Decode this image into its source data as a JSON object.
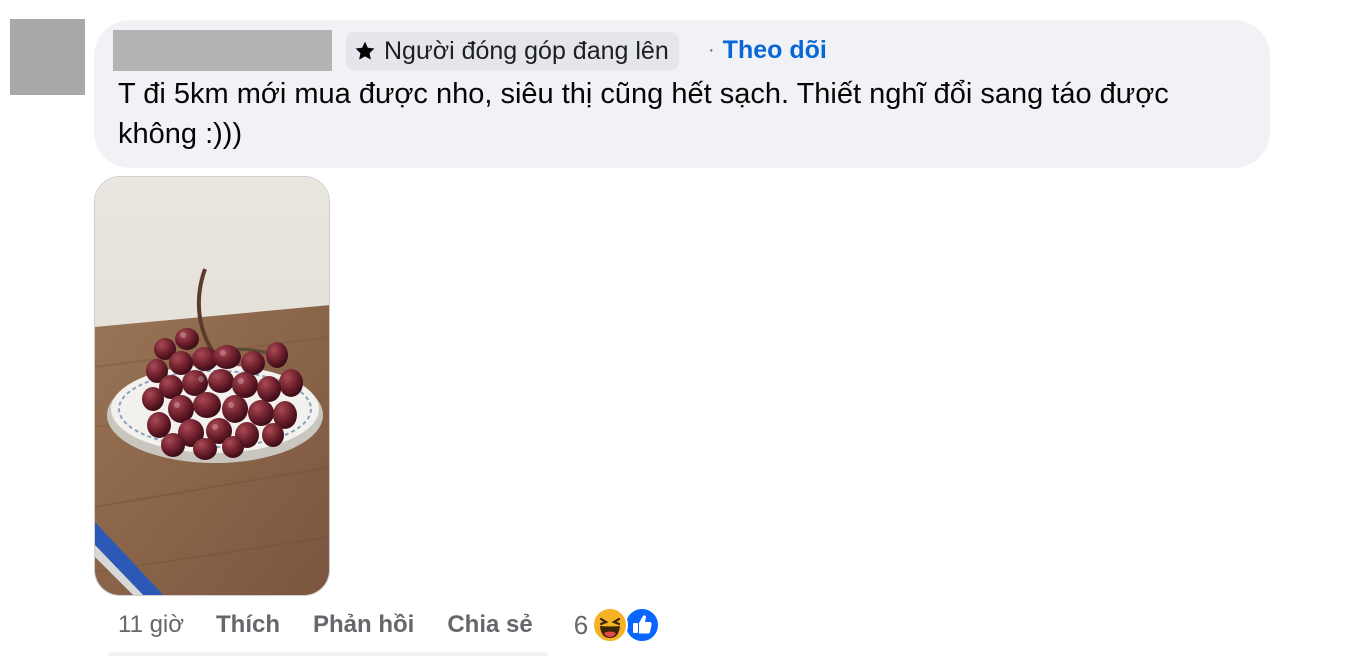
{
  "comment": {
    "badge_label": "Người đóng góp đang lên",
    "separator": "·",
    "follow_label": "Theo dõi",
    "text": "T đi 5km mới mua được nho, siêu thị cũng hết sạch. Thiết nghĩ đổi sang táo được không :)))"
  },
  "actions": {
    "time": "11 giờ",
    "like_label": "Thích",
    "reply_label": "Phản hồi",
    "share_label": "Chia sẻ",
    "reaction_count": "6"
  },
  "icons": {
    "badge": "star-icon",
    "reactions": [
      "haha-icon",
      "like-icon"
    ]
  },
  "colors": {
    "bubble": "#f0f2f5",
    "follow_link": "#0866d6",
    "secondary_text": "#65676b",
    "like_blue": "#0866ff",
    "haha_yellow": "#f7b125"
  }
}
